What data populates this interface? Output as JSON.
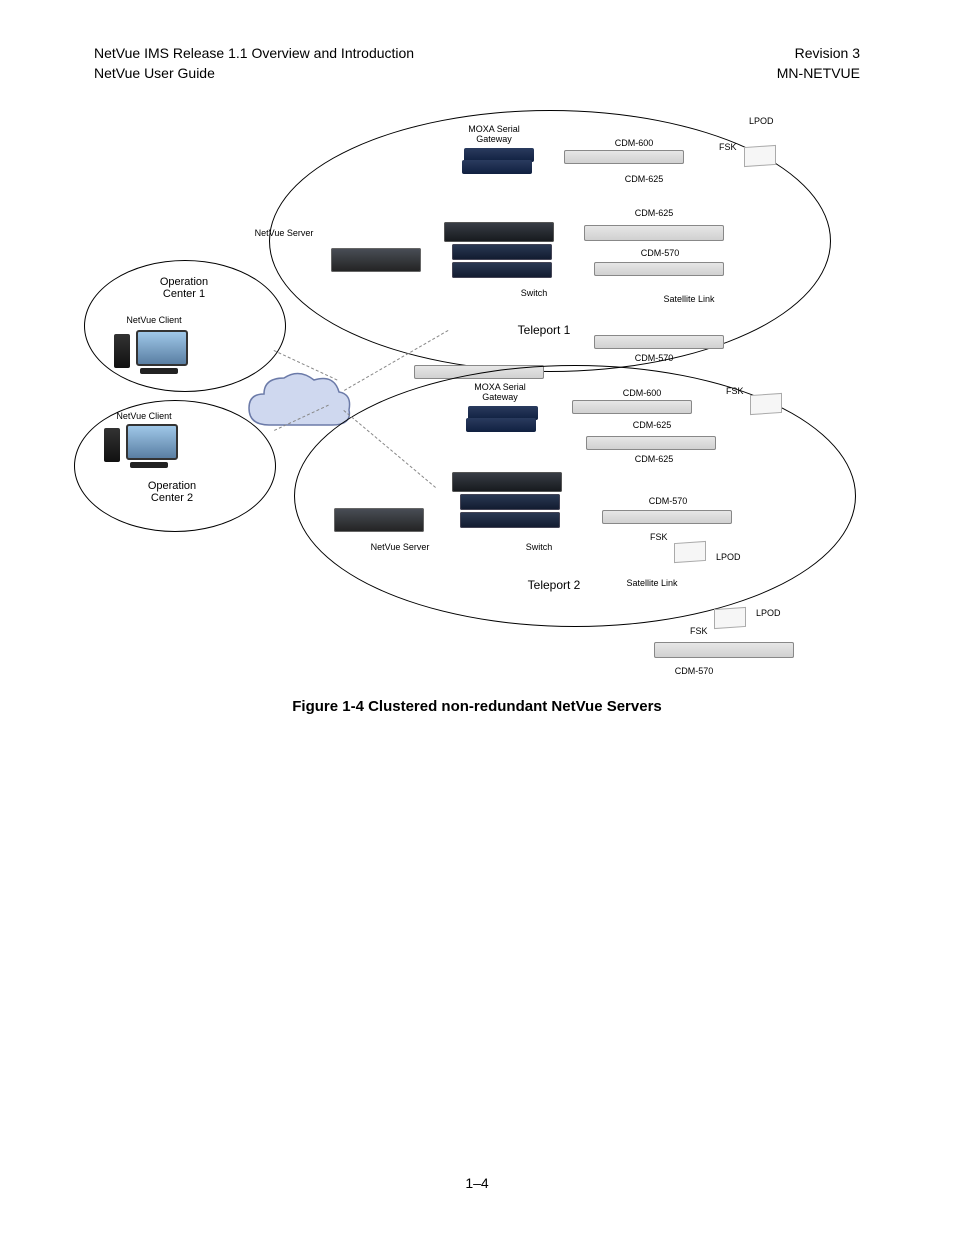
{
  "header": {
    "left_line1": "NetVue IMS Release 1.1 Overview and Introduction",
    "left_line2": "NetVue User Guide",
    "right_line1": "Revision 3",
    "right_line2": "MN-NETVUE"
  },
  "diagram": {
    "op_center_1": {
      "title": "Operation\nCenter 1",
      "client": "NetVue Client"
    },
    "op_center_2": {
      "title": "Operation\nCenter 2",
      "client": "NetVue Client"
    },
    "teleport_1": {
      "title": "Teleport 1",
      "server": "NetVue Server",
      "moxa": "MOXA Serial\nGateway",
      "switch": "Switch",
      "devices": {
        "cdm600": "CDM-600",
        "cdm625a": "CDM-625",
        "cdm625b": "CDM-625",
        "cdm570": "CDM-570",
        "cdm570b": "CDM-570"
      },
      "fsk": "FSK",
      "lpod": "LPOD",
      "satlink": "Satellite Link"
    },
    "teleport_2": {
      "title": "Teleport 2",
      "server": "NetVue Server",
      "moxa": "MOXA Serial\nGateway",
      "switch": "Switch",
      "devices": {
        "cdm600": "CDM-600",
        "cdm625a": "CDM-625",
        "cdm625b": "CDM-625",
        "cdm570": "CDM-570",
        "cdm570b": "CDM-570"
      },
      "fsk": "FSK",
      "lpod": "LPOD",
      "satlink": "Satellite Link"
    }
  },
  "caption": "Figure 1-4 Clustered non-redundant NetVue Servers",
  "footer": "1–4"
}
